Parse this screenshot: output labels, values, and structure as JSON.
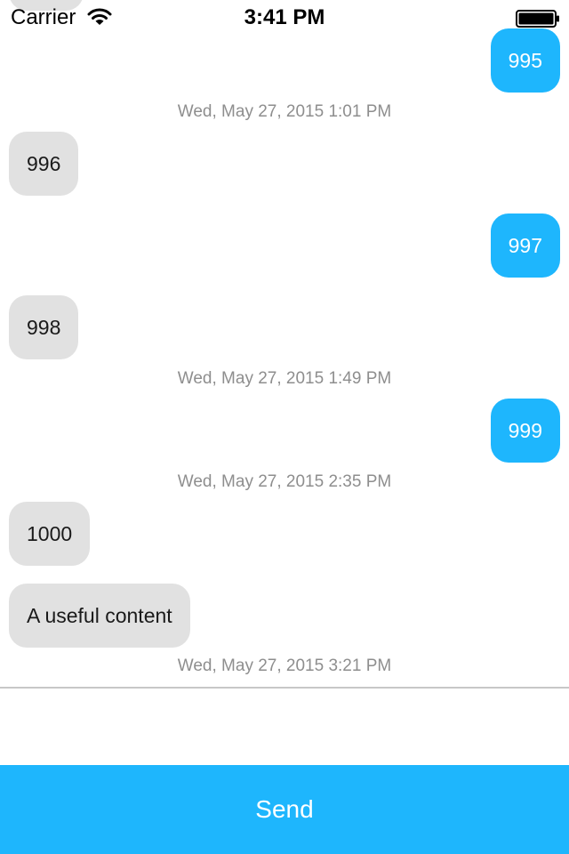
{
  "status_bar": {
    "carrier": "Carrier",
    "time": "3:41 PM",
    "wifi_icon": "wifi-icon",
    "battery_icon": "battery-icon"
  },
  "messages": [
    {
      "direction": "outgoing",
      "text": "995"
    },
    {
      "timestamp": "Wed, May 27, 2015 1:01 PM"
    },
    {
      "direction": "incoming",
      "text": "996"
    },
    {
      "direction": "outgoing",
      "text": "997"
    },
    {
      "direction": "incoming",
      "text": "998"
    },
    {
      "timestamp": "Wed, May 27, 2015 1:49 PM"
    },
    {
      "direction": "outgoing",
      "text": "999"
    },
    {
      "timestamp": "Wed, May 27, 2015 2:35 PM"
    },
    {
      "direction": "incoming",
      "text": "1000"
    },
    {
      "direction": "incoming",
      "text": "A useful content"
    },
    {
      "timestamp": "Wed, May 27, 2015 3:21 PM"
    }
  ],
  "composer": {
    "input_value": "",
    "send_label": "Send"
  },
  "colors": {
    "outgoing_bubble": "#1eb6fd",
    "incoming_bubble": "#e1e1e1",
    "send_button": "#1eb6fd",
    "timestamp_text": "#8e8e8e"
  }
}
